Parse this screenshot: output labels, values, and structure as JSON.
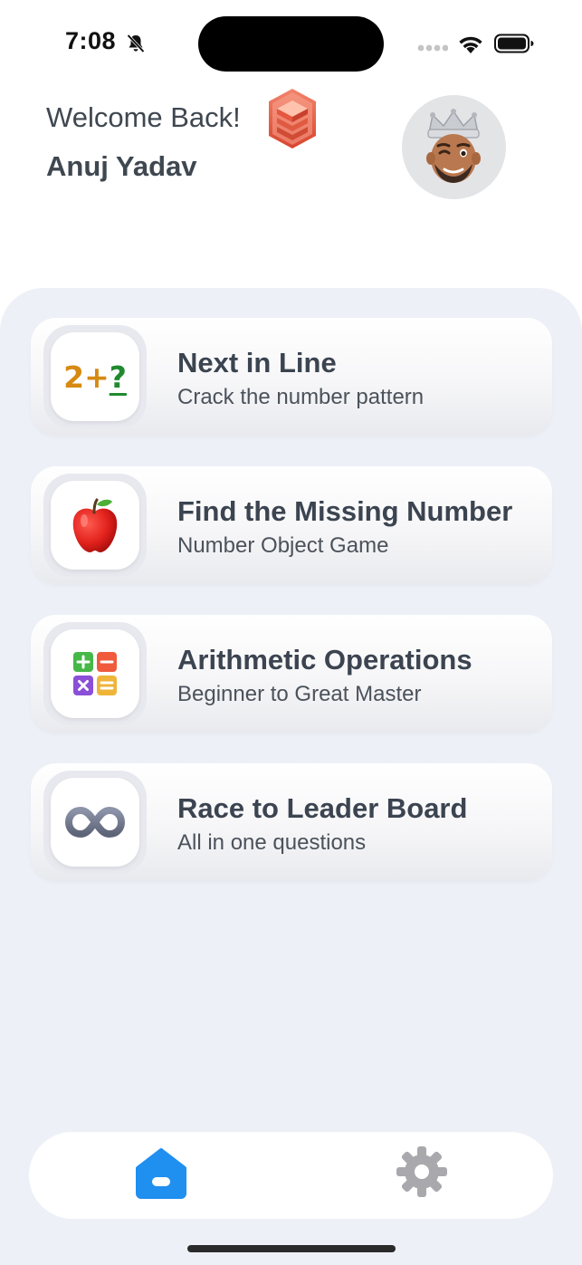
{
  "status_bar": {
    "time": "7:08"
  },
  "header": {
    "welcome": "Welcome Back!",
    "user_name": "Anuj Yadav"
  },
  "cards": [
    {
      "title": "Next in Line",
      "subtitle": "Crack the number pattern",
      "icon": "number-pattern-icon"
    },
    {
      "title": "Find the Missing Number",
      "subtitle": "Number Object Game",
      "icon": "apple-icon"
    },
    {
      "title": "Arithmetic Operations",
      "subtitle": "Beginner to Great Master",
      "icon": "calculator-icon"
    },
    {
      "title": "Race to Leader Board",
      "subtitle": "All in one questions",
      "icon": "infinity-icon"
    }
  ],
  "icon1": {
    "left": "2+",
    "right": "?"
  },
  "nav": {
    "items": [
      "home-icon",
      "gear-icon"
    ],
    "active": "home"
  },
  "colors": {
    "accent": "#1f8ff0",
    "panel": "#edf0f7",
    "text": "#3b4450"
  }
}
